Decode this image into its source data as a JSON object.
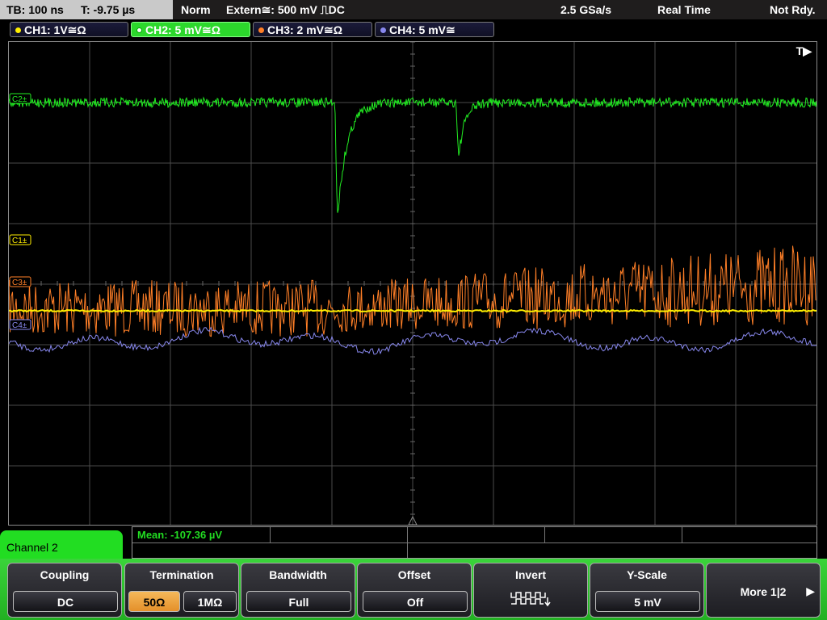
{
  "statusbar": {
    "timebase": "TB: 100 ns",
    "trigger_time": "T: -9.75 µs",
    "mode": "Norm",
    "trigger_source": "Extern≅: 500 mV ⎍DC",
    "sample_rate": "2.5 GSa/s",
    "acq_mode": "Real Time",
    "status": "Not Rdy."
  },
  "channels": [
    {
      "label": "CH1: 1V≅Ω",
      "color": "#ffee00"
    },
    {
      "label": "CH2: 5 mV≅Ω",
      "color": "#22ee22"
    },
    {
      "label": "CH3: 2 mV≅Ω",
      "color": "#ff7f27"
    },
    {
      "label": "CH4: 5 mV≅",
      "color": "#8888ee"
    }
  ],
  "grid": {
    "trigger_marker": "T▶",
    "markers": [
      "C2",
      "C1",
      "C3",
      "C4"
    ]
  },
  "measurement": {
    "mean": "Mean: -107.36 µV"
  },
  "menu": {
    "title": "Channel 2",
    "coupling": {
      "label": "Coupling",
      "value": "DC"
    },
    "termination": {
      "label": "Termination",
      "options": [
        "50Ω",
        "1MΩ"
      ],
      "selected": "50Ω"
    },
    "bandwidth": {
      "label": "Bandwidth",
      "value": "Full"
    },
    "offset": {
      "label": "Offset",
      "value": "Off"
    },
    "invert": {
      "label": "Invert",
      "icon": "invert-square-wave-icon"
    },
    "yscale": {
      "label": "Y-Scale",
      "value": "5 mV"
    },
    "more": {
      "label": "More 1|2",
      "icon": "arrow-right-icon"
    }
  },
  "colors": {
    "ch1": "#ffee00",
    "ch2": "#22ee22",
    "ch3": "#ff7f27",
    "ch4": "#8888ee",
    "grid": "#4a4a4a",
    "softkey_bar": "#2cc82c",
    "selected_option": "#f0a040"
  }
}
